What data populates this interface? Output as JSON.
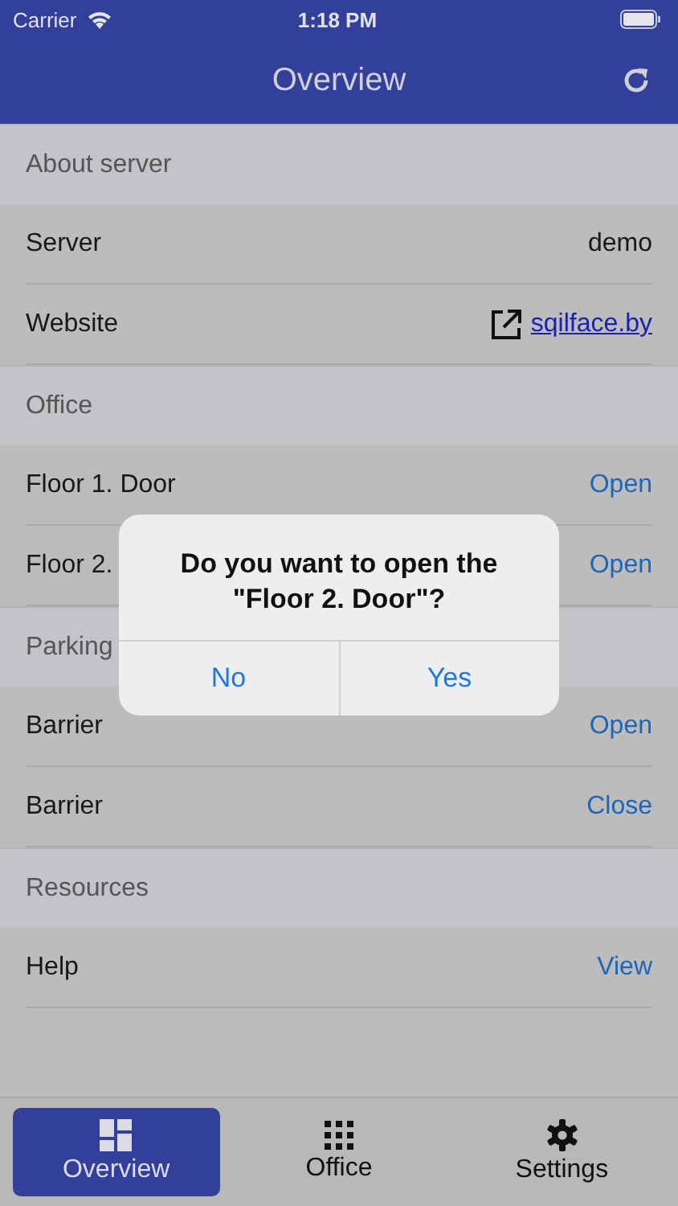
{
  "status_bar": {
    "carrier": "Carrier",
    "time": "1:18 PM"
  },
  "nav": {
    "title": "Overview"
  },
  "sections": [
    {
      "title": "About server",
      "rows": [
        {
          "label": "Server",
          "value": "demo",
          "kind": "text"
        },
        {
          "label": "Website",
          "value": "sqilface.by",
          "kind": "link"
        }
      ]
    },
    {
      "title": "Office",
      "rows": [
        {
          "label": "Floor 1. Door",
          "value": "Open",
          "kind": "action"
        },
        {
          "label": "Floor 2.",
          "value": "Open",
          "kind": "action"
        }
      ]
    },
    {
      "title": "Parking",
      "rows": [
        {
          "label": "Barrier",
          "value": "Open",
          "kind": "action"
        },
        {
          "label": "Barrier",
          "value": "Close",
          "kind": "action"
        }
      ]
    },
    {
      "title": "Resources",
      "rows": [
        {
          "label": "Help",
          "value": "View",
          "kind": "action"
        }
      ]
    }
  ],
  "dialog": {
    "message": "Do you want to open the \"Floor 2. Door\"?",
    "buttons": [
      "No",
      "Yes"
    ]
  },
  "tabs": [
    {
      "label": "Overview",
      "selected": true,
      "kind": "dashboard"
    },
    {
      "label": "Office",
      "selected": false,
      "kind": "grid"
    },
    {
      "label": "Settings",
      "selected": false,
      "kind": "gear"
    }
  ]
}
